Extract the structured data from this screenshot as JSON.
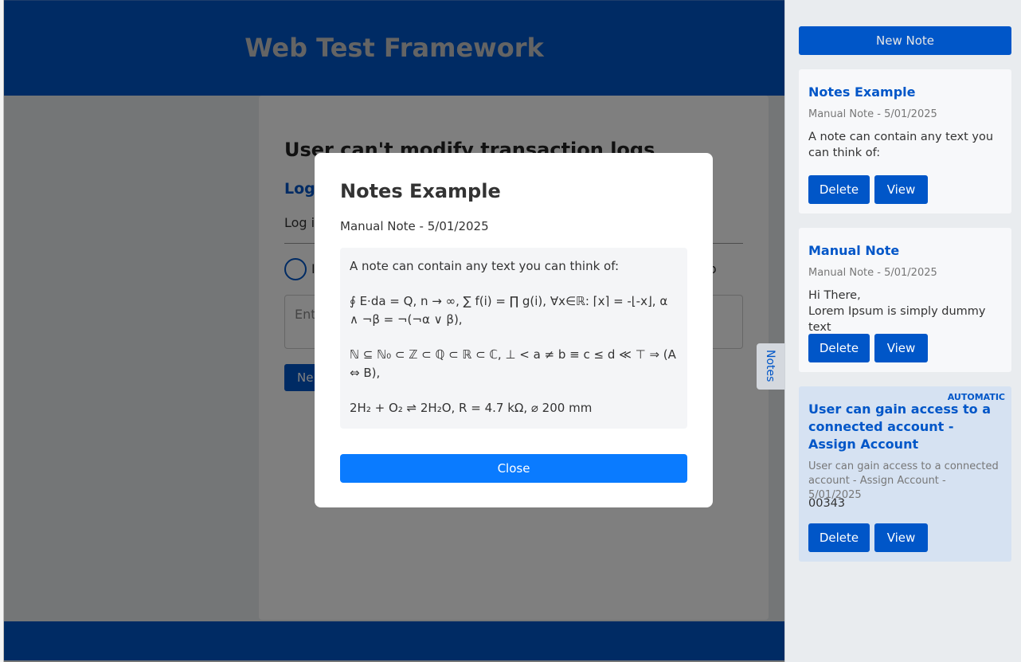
{
  "app": {
    "title": "Web Test Framework"
  },
  "card": {
    "title": "User can't modify transaction logs",
    "subtitle": "Logi",
    "text": "Log i",
    "radio_label": "I",
    "radio_tail": "ip",
    "input_placeholder": "Ent",
    "next_button": "Ne"
  },
  "modal": {
    "title": "Notes Example",
    "meta": "Manual Note - 5/01/2025",
    "body": [
      "A note can contain any text you can think of:",
      "∮ E⋅da = Q, n → ∞, ∑ f(i) = ∏ g(i), ∀x∈ℝ: ⌈x⌉ = -⌊-x⌋, α ∧ ¬β = ¬(¬α ∨ β),",
      "ℕ ⊆ ℕ₀ ⊂ ℤ ⊂ ℚ ⊂ ℝ ⊂ ℂ, ⊥ < a ≠ b ≡ c ≤ d ≪ ⊤ ⇒ (A ⇔ B),",
      "2H₂ + O₂ ⇌ 2H₂O, R = 4.7 kΩ, ⌀ 200 mm"
    ],
    "close_label": "Close"
  },
  "notes_tab": {
    "label": "Notes"
  },
  "sidebar": {
    "new_note_label": "New Note",
    "notes": [
      {
        "title": "Notes Example",
        "meta": "Manual Note - 5/01/2025",
        "body": "A note can contain any text you can think of:",
        "delete_label": "Delete",
        "view_label": "View"
      },
      {
        "title": "Manual Note",
        "meta": "Manual Note - 5/01/2025",
        "body_line1": "Hi There,",
        "body_line2": "Lorem Ipsum is simply dummy text",
        "delete_label": "Delete",
        "view_label": "View"
      },
      {
        "badge": "AUTOMATIC",
        "title": "User can gain access to a connected account - Assign Account",
        "meta": "User can gain access to a connected account - Assign Account - 5/01/2025",
        "body": "00343",
        "delete_label": "Delete",
        "view_label": "View"
      }
    ]
  }
}
